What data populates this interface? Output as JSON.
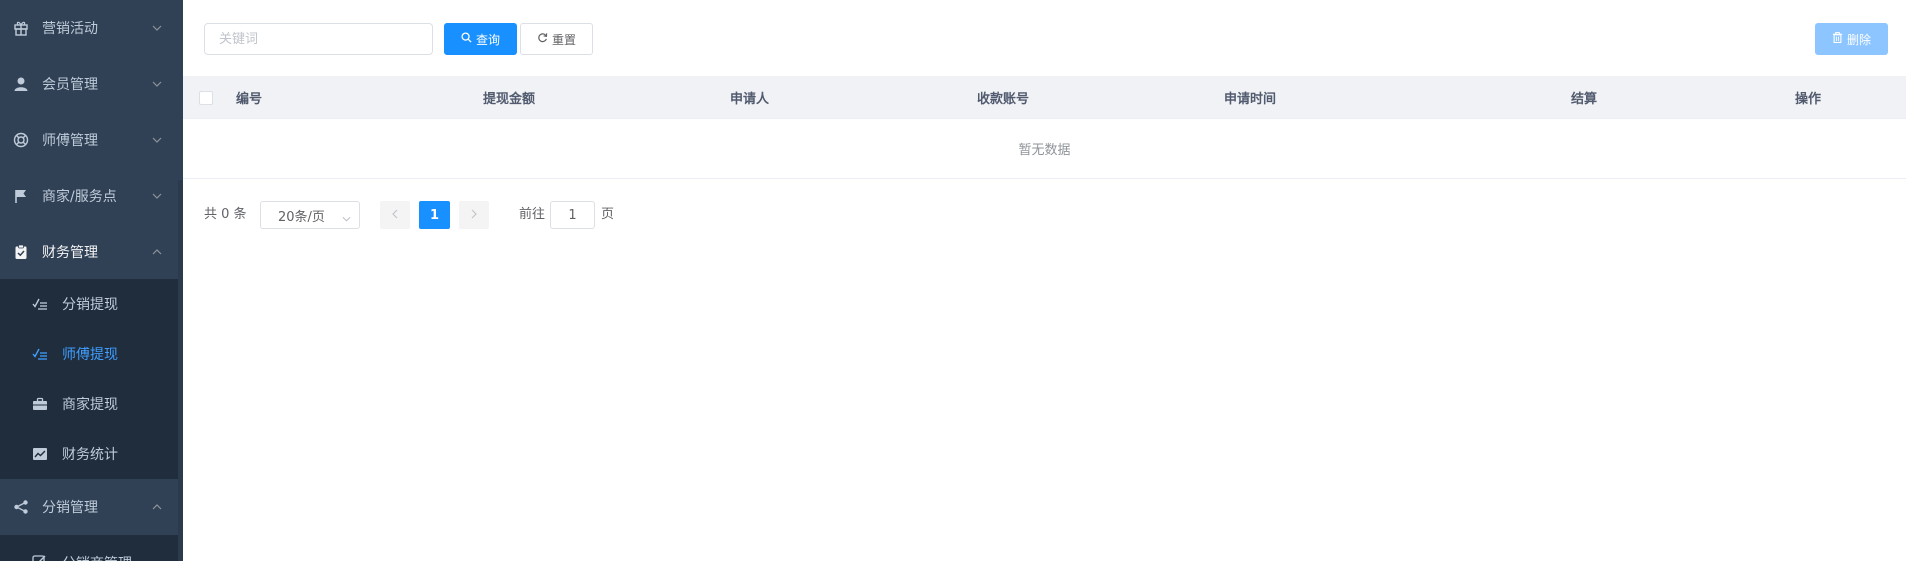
{
  "sidebar": {
    "menu": [
      {
        "label": "营销活动",
        "icon": "gift-icon"
      },
      {
        "label": "会员管理",
        "icon": "user-icon"
      },
      {
        "label": "师傅管理",
        "icon": "lifebuoy-icon"
      },
      {
        "label": "商家/服务点",
        "icon": "flag-icon"
      },
      {
        "label": "财务管理",
        "icon": "clipboard-check-icon"
      },
      {
        "label": "分销管理",
        "icon": "share-icon"
      }
    ],
    "finance_sub": [
      {
        "label": "分销提现",
        "icon": "checklist-icon"
      },
      {
        "label": "师傅提现",
        "icon": "checklist-icon"
      },
      {
        "label": "商家提现",
        "icon": "briefcase-icon"
      },
      {
        "label": "财务统计",
        "icon": "trend-chart-icon"
      }
    ],
    "distribution_sub": [
      {
        "label": "分销商管理",
        "icon": "edit-icon"
      }
    ]
  },
  "toolbar": {
    "search_placeholder": "关键词",
    "search_value": "",
    "search_label": "查询",
    "reset_label": "重置",
    "delete_label": "删除"
  },
  "table": {
    "columns": [
      "编号",
      "提现金额",
      "申请人",
      "收款账号",
      "申请时间",
      "结算",
      "操作"
    ],
    "empty_text": "暂无数据"
  },
  "pagination": {
    "total_text": "共 0 条",
    "page_size": "20条/页",
    "current_page": "1",
    "goto_label": "前往",
    "goto_value": "1",
    "page_suffix": "页"
  },
  "colors": {
    "sidebar_bg": "#304156",
    "submenu_bg": "#1f2d3d",
    "active": "#409eff",
    "primary": "#1890ff"
  }
}
